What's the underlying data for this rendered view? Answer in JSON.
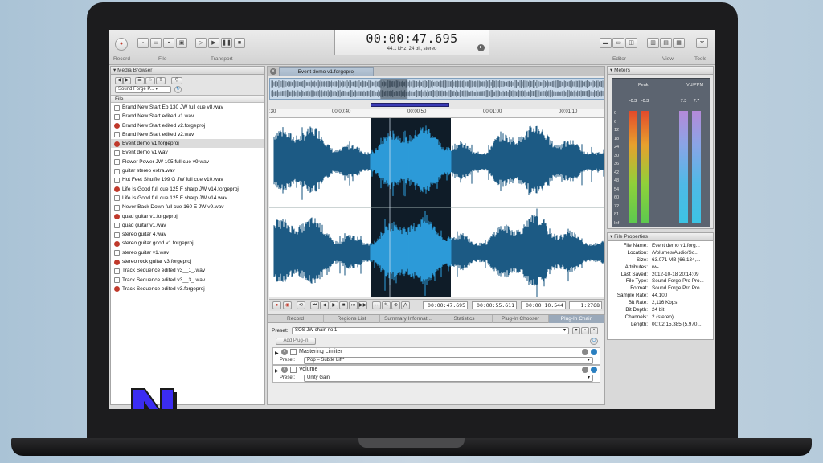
{
  "toolbar": {
    "groups": [
      "Record",
      "File",
      "Transport",
      "Editor",
      "View",
      "Tools"
    ],
    "time": "00:00:47.695",
    "format": "44.1 kHz, 24 bit, stereo"
  },
  "media_browser": {
    "title": "Media Browser",
    "location": "Sound Forge P...",
    "column": "File",
    "files": [
      {
        "name": "Brand New Start Eb 130 JW full cue v8.wav",
        "type": "wav"
      },
      {
        "name": "Brand New Start edited v1.wav",
        "type": "wav"
      },
      {
        "name": "Brand New Start edited v2.forgeproj",
        "type": "proj"
      },
      {
        "name": "Brand New Start edited v2.wav",
        "type": "wav"
      },
      {
        "name": "Event demo v1.forgeproj",
        "type": "proj",
        "selected": true
      },
      {
        "name": "Event demo v1.wav",
        "type": "wav"
      },
      {
        "name": "Flower Power JW 105 full cue v9.wav",
        "type": "wav"
      },
      {
        "name": "guitar stereo extra.wav",
        "type": "wav"
      },
      {
        "name": "Hot Feet Shuffle 199 G JW full cue v10.wav",
        "type": "wav"
      },
      {
        "name": "Life Is Good full cue 125 F sharp JW v14.forgeproj",
        "type": "proj"
      },
      {
        "name": "Life Is Good full cue 125 F sharp JW v14.wav",
        "type": "wav"
      },
      {
        "name": "Never Back Down full cue 160 E JW v9.wav",
        "type": "wav"
      },
      {
        "name": "quad guitar v1.forgeproj",
        "type": "proj"
      },
      {
        "name": "quad guitar v1.wav",
        "type": "wav"
      },
      {
        "name": "stereo guitar 4.wav",
        "type": "wav"
      },
      {
        "name": "stereo guitar good v1.forgeproj",
        "type": "proj"
      },
      {
        "name": "stereo guitar v1.wav",
        "type": "wav"
      },
      {
        "name": "stereo rock guitar v3.forgeproj",
        "type": "proj"
      },
      {
        "name": "Track Sequence edited v3__1_.wav",
        "type": "wav"
      },
      {
        "name": "Track Sequence edited v3__3_.wav",
        "type": "wav"
      },
      {
        "name": "Track Sequence edited v3.forgeproj",
        "type": "proj"
      }
    ]
  },
  "editor": {
    "tab": "Event demo v1.forgeproj",
    "ruler": [
      ":30",
      "00:00:40",
      "00:00:50",
      "00:01:00",
      "00:01:10"
    ],
    "transport": {
      "cursor": "00:00:47.695",
      "sel_end": "00:00:55.611",
      "sel_len": "00:00:10.544",
      "zoom": "1:2768"
    }
  },
  "chain": {
    "tabs": [
      "Record",
      "Regions List",
      "Summary Informat...",
      "Statistics",
      "Plug-In Chooser",
      "Plug-In Chain"
    ],
    "preset_label": "Preset:",
    "chain_preset": "SOS JW chain no 1",
    "add_plugin": "Add Plug-in",
    "plugins": [
      {
        "name": "Mastering Limiter",
        "preset": "Pop – Subtle Lift*"
      },
      {
        "name": "Volume",
        "preset": "Unity Gain"
      }
    ]
  },
  "meters": {
    "title": "Meters",
    "peak_label": "Peak",
    "vu_label": "VU/PPM",
    "peak_values": [
      "-0.3",
      "-0.3"
    ],
    "vu_values": [
      "7.3",
      "7.7"
    ],
    "scale": [
      "0",
      "6",
      "12",
      "18",
      "24",
      "30",
      "36",
      "42",
      "48",
      "54",
      "60",
      "72",
      "81",
      "Inf"
    ]
  },
  "file_properties": {
    "title": "File Properties",
    "rows": [
      {
        "k": "File Name:",
        "v": "Event demo v1.forg..."
      },
      {
        "k": "Location:",
        "v": "/Volumes/Audio/So..."
      },
      {
        "k": "Size:",
        "v": "63.071 MB (66,134,..."
      },
      {
        "k": "Attributes:",
        "v": "rw-"
      },
      {
        "k": "Last Saved:",
        "v": "2012-10-18 20:14:09"
      },
      {
        "k": "File Type:",
        "v": "Sound Forge Pro Pro..."
      },
      {
        "k": "Format:",
        "v": "Sound Forge Pro Pro..."
      },
      {
        "k": "Sample Rate:",
        "v": "44,100"
      },
      {
        "k": "Bit Rate:",
        "v": "2,116 Kbps"
      },
      {
        "k": "Bit Depth:",
        "v": "24 bit"
      },
      {
        "k": "Channels:",
        "v": "2 (stereo)"
      },
      {
        "k": "Length:",
        "v": "00:02:15.385 (5,970..."
      }
    ]
  },
  "colors": {
    "waveform": "#1d5a84",
    "selection_bg": "#0f1c28",
    "selection_wave": "#2d9bd8",
    "record": "#c0392b"
  }
}
